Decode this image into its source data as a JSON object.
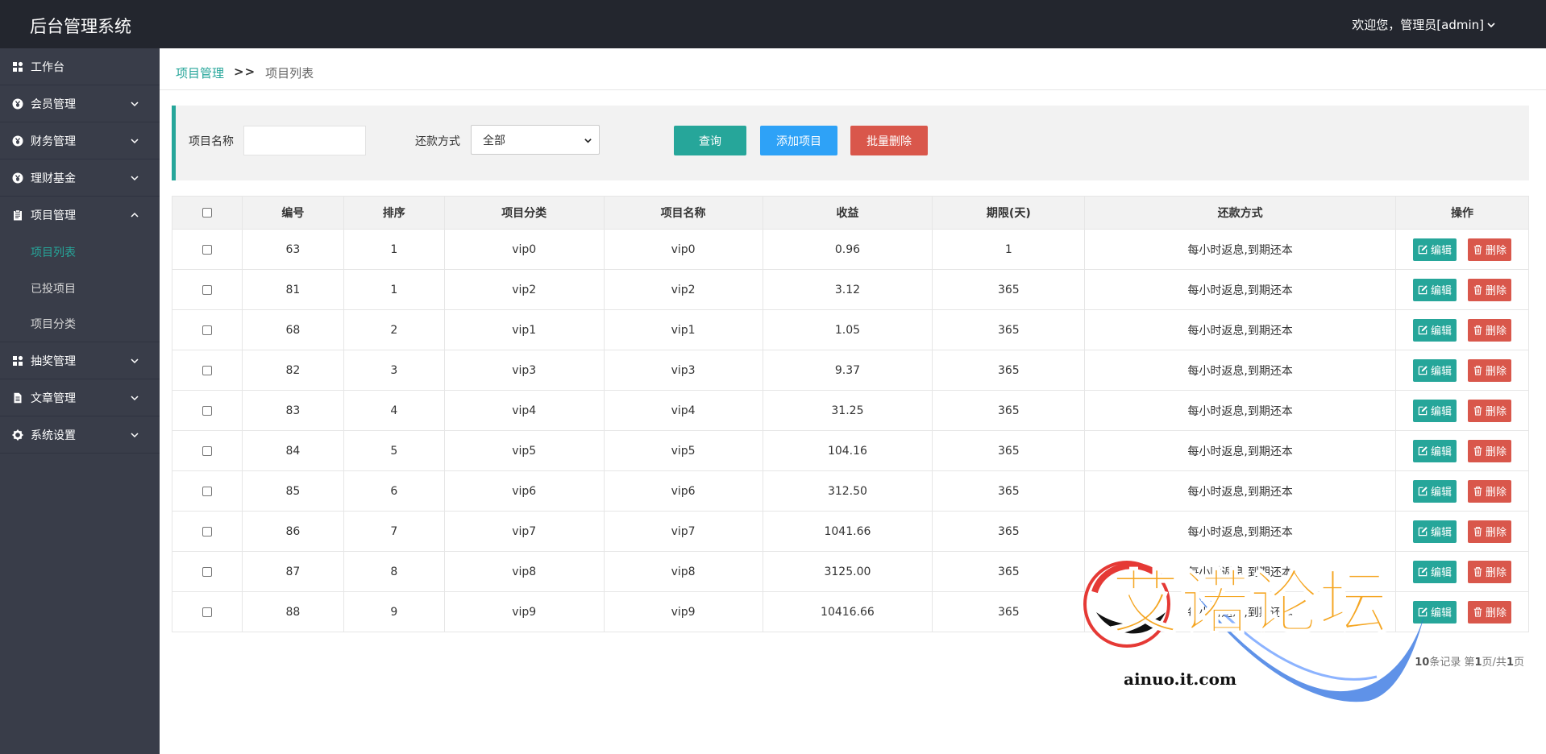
{
  "header": {
    "title": "后台管理系统",
    "user_greeting": "欢迎您，管理员[admin]"
  },
  "sidebar": {
    "items": [
      {
        "label": "工作台",
        "icon": "dashboard-icon"
      },
      {
        "label": "会员管理",
        "icon": "yen-circle-icon"
      },
      {
        "label": "财务管理",
        "icon": "yen-circle-icon"
      },
      {
        "label": "理财基金",
        "icon": "yen-circle-icon"
      },
      {
        "label": "项目管理",
        "icon": "clipboard-icon"
      },
      {
        "label": "抽奖管理",
        "icon": "dashboard-icon"
      },
      {
        "label": "文章管理",
        "icon": "file-icon"
      },
      {
        "label": "系统设置",
        "icon": "gear-icon"
      }
    ],
    "project_subitems": [
      {
        "label": "项目列表"
      },
      {
        "label": "已投项目"
      },
      {
        "label": "项目分类"
      }
    ]
  },
  "breadcrumb": {
    "parent": "项目管理",
    "separator": ">>",
    "current": "项目列表"
  },
  "filter": {
    "name_label": "项目名称",
    "name_value": "",
    "repay_label": "还款方式",
    "repay_selected": "全部",
    "query_button": "查询",
    "add_button": "添加项目",
    "batch_delete_button": "批量删除"
  },
  "table": {
    "headers": [
      "编号",
      "排序",
      "项目分类",
      "项目名称",
      "收益",
      "期限(天)",
      "还款方式",
      "操作"
    ],
    "edit_label": "编辑",
    "delete_label": "删除",
    "rows": [
      {
        "id": "63",
        "sort": "1",
        "category": "vip0",
        "name": "vip0",
        "income": "0.96",
        "term": "1",
        "repay": "每小时返息,到期还本"
      },
      {
        "id": "81",
        "sort": "1",
        "category": "vip2",
        "name": "vip2",
        "income": "3.12",
        "term": "365",
        "repay": "每小时返息,到期还本"
      },
      {
        "id": "68",
        "sort": "2",
        "category": "vip1",
        "name": "vip1",
        "income": "1.05",
        "term": "365",
        "repay": "每小时返息,到期还本"
      },
      {
        "id": "82",
        "sort": "3",
        "category": "vip3",
        "name": "vip3",
        "income": "9.37",
        "term": "365",
        "repay": "每小时返息,到期还本"
      },
      {
        "id": "83",
        "sort": "4",
        "category": "vip4",
        "name": "vip4",
        "income": "31.25",
        "term": "365",
        "repay": "每小时返息,到期还本"
      },
      {
        "id": "84",
        "sort": "5",
        "category": "vip5",
        "name": "vip5",
        "income": "104.16",
        "term": "365",
        "repay": "每小时返息,到期还本"
      },
      {
        "id": "85",
        "sort": "6",
        "category": "vip6",
        "name": "vip6",
        "income": "312.50",
        "term": "365",
        "repay": "每小时返息,到期还本"
      },
      {
        "id": "86",
        "sort": "7",
        "category": "vip7",
        "name": "vip7",
        "income": "1041.66",
        "term": "365",
        "repay": "每小时返息,到期还本"
      },
      {
        "id": "87",
        "sort": "8",
        "category": "vip8",
        "name": "vip8",
        "income": "3125.00",
        "term": "365",
        "repay": "每小时返息,到期还本"
      },
      {
        "id": "88",
        "sort": "9",
        "category": "vip9",
        "name": "vip9",
        "income": "10416.66",
        "term": "365",
        "repay": "每小时返息,到期还本"
      }
    ]
  },
  "pager": {
    "count_text": "10",
    "record_unit": "条记录",
    "page_prefix": "第",
    "page_current": "1",
    "page_mid": "页/共",
    "page_total": "1",
    "page_suffix": "页"
  },
  "watermark": {
    "text": "艾诺论坛",
    "url": "ainuo.it.com"
  }
}
